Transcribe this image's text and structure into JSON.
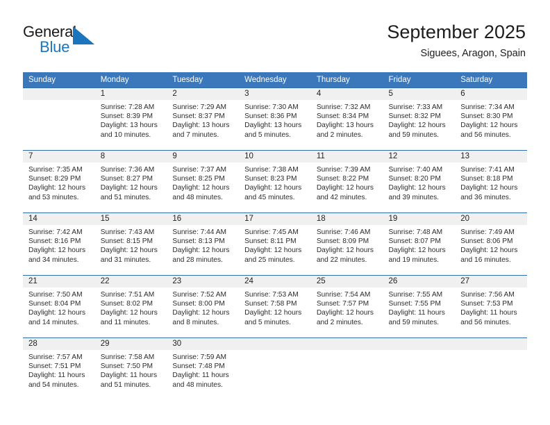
{
  "brand": {
    "name_part1": "General",
    "name_part2": "Blue",
    "accent_color": "#1b75bc"
  },
  "header": {
    "title": "September 2025",
    "subtitle": "Siguees, Aragon, Spain"
  },
  "calendar": {
    "header_bg": "#3a78bb",
    "row_rule_color": "#2e6cab",
    "day_band_bg": "#f0f0f0",
    "weekday_headers": [
      "Sunday",
      "Monday",
      "Tuesday",
      "Wednesday",
      "Thursday",
      "Friday",
      "Saturday"
    ],
    "weeks": [
      [
        {
          "day": "",
          "lines": []
        },
        {
          "day": "1",
          "lines": [
            "Sunrise: 7:28 AM",
            "Sunset: 8:39 PM",
            "Daylight: 13 hours",
            "and 10 minutes."
          ]
        },
        {
          "day": "2",
          "lines": [
            "Sunrise: 7:29 AM",
            "Sunset: 8:37 PM",
            "Daylight: 13 hours",
            "and 7 minutes."
          ]
        },
        {
          "day": "3",
          "lines": [
            "Sunrise: 7:30 AM",
            "Sunset: 8:36 PM",
            "Daylight: 13 hours",
            "and 5 minutes."
          ]
        },
        {
          "day": "4",
          "lines": [
            "Sunrise: 7:32 AM",
            "Sunset: 8:34 PM",
            "Daylight: 13 hours",
            "and 2 minutes."
          ]
        },
        {
          "day": "5",
          "lines": [
            "Sunrise: 7:33 AM",
            "Sunset: 8:32 PM",
            "Daylight: 12 hours",
            "and 59 minutes."
          ]
        },
        {
          "day": "6",
          "lines": [
            "Sunrise: 7:34 AM",
            "Sunset: 8:30 PM",
            "Daylight: 12 hours",
            "and 56 minutes."
          ]
        }
      ],
      [
        {
          "day": "7",
          "lines": [
            "Sunrise: 7:35 AM",
            "Sunset: 8:29 PM",
            "Daylight: 12 hours",
            "and 53 minutes."
          ]
        },
        {
          "day": "8",
          "lines": [
            "Sunrise: 7:36 AM",
            "Sunset: 8:27 PM",
            "Daylight: 12 hours",
            "and 51 minutes."
          ]
        },
        {
          "day": "9",
          "lines": [
            "Sunrise: 7:37 AM",
            "Sunset: 8:25 PM",
            "Daylight: 12 hours",
            "and 48 minutes."
          ]
        },
        {
          "day": "10",
          "lines": [
            "Sunrise: 7:38 AM",
            "Sunset: 8:23 PM",
            "Daylight: 12 hours",
            "and 45 minutes."
          ]
        },
        {
          "day": "11",
          "lines": [
            "Sunrise: 7:39 AM",
            "Sunset: 8:22 PM",
            "Daylight: 12 hours",
            "and 42 minutes."
          ]
        },
        {
          "day": "12",
          "lines": [
            "Sunrise: 7:40 AM",
            "Sunset: 8:20 PM",
            "Daylight: 12 hours",
            "and 39 minutes."
          ]
        },
        {
          "day": "13",
          "lines": [
            "Sunrise: 7:41 AM",
            "Sunset: 8:18 PM",
            "Daylight: 12 hours",
            "and 36 minutes."
          ]
        }
      ],
      [
        {
          "day": "14",
          "lines": [
            "Sunrise: 7:42 AM",
            "Sunset: 8:16 PM",
            "Daylight: 12 hours",
            "and 34 minutes."
          ]
        },
        {
          "day": "15",
          "lines": [
            "Sunrise: 7:43 AM",
            "Sunset: 8:15 PM",
            "Daylight: 12 hours",
            "and 31 minutes."
          ]
        },
        {
          "day": "16",
          "lines": [
            "Sunrise: 7:44 AM",
            "Sunset: 8:13 PM",
            "Daylight: 12 hours",
            "and 28 minutes."
          ]
        },
        {
          "day": "17",
          "lines": [
            "Sunrise: 7:45 AM",
            "Sunset: 8:11 PM",
            "Daylight: 12 hours",
            "and 25 minutes."
          ]
        },
        {
          "day": "18",
          "lines": [
            "Sunrise: 7:46 AM",
            "Sunset: 8:09 PM",
            "Daylight: 12 hours",
            "and 22 minutes."
          ]
        },
        {
          "day": "19",
          "lines": [
            "Sunrise: 7:48 AM",
            "Sunset: 8:07 PM",
            "Daylight: 12 hours",
            "and 19 minutes."
          ]
        },
        {
          "day": "20",
          "lines": [
            "Sunrise: 7:49 AM",
            "Sunset: 8:06 PM",
            "Daylight: 12 hours",
            "and 16 minutes."
          ]
        }
      ],
      [
        {
          "day": "21",
          "lines": [
            "Sunrise: 7:50 AM",
            "Sunset: 8:04 PM",
            "Daylight: 12 hours",
            "and 14 minutes."
          ]
        },
        {
          "day": "22",
          "lines": [
            "Sunrise: 7:51 AM",
            "Sunset: 8:02 PM",
            "Daylight: 12 hours",
            "and 11 minutes."
          ]
        },
        {
          "day": "23",
          "lines": [
            "Sunrise: 7:52 AM",
            "Sunset: 8:00 PM",
            "Daylight: 12 hours",
            "and 8 minutes."
          ]
        },
        {
          "day": "24",
          "lines": [
            "Sunrise: 7:53 AM",
            "Sunset: 7:58 PM",
            "Daylight: 12 hours",
            "and 5 minutes."
          ]
        },
        {
          "day": "25",
          "lines": [
            "Sunrise: 7:54 AM",
            "Sunset: 7:57 PM",
            "Daylight: 12 hours",
            "and 2 minutes."
          ]
        },
        {
          "day": "26",
          "lines": [
            "Sunrise: 7:55 AM",
            "Sunset: 7:55 PM",
            "Daylight: 11 hours",
            "and 59 minutes."
          ]
        },
        {
          "day": "27",
          "lines": [
            "Sunrise: 7:56 AM",
            "Sunset: 7:53 PM",
            "Daylight: 11 hours",
            "and 56 minutes."
          ]
        }
      ],
      [
        {
          "day": "28",
          "lines": [
            "Sunrise: 7:57 AM",
            "Sunset: 7:51 PM",
            "Daylight: 11 hours",
            "and 54 minutes."
          ]
        },
        {
          "day": "29",
          "lines": [
            "Sunrise: 7:58 AM",
            "Sunset: 7:50 PM",
            "Daylight: 11 hours",
            "and 51 minutes."
          ]
        },
        {
          "day": "30",
          "lines": [
            "Sunrise: 7:59 AM",
            "Sunset: 7:48 PM",
            "Daylight: 11 hours",
            "and 48 minutes."
          ]
        },
        {
          "day": "",
          "lines": []
        },
        {
          "day": "",
          "lines": []
        },
        {
          "day": "",
          "lines": []
        },
        {
          "day": "",
          "lines": []
        }
      ]
    ]
  }
}
